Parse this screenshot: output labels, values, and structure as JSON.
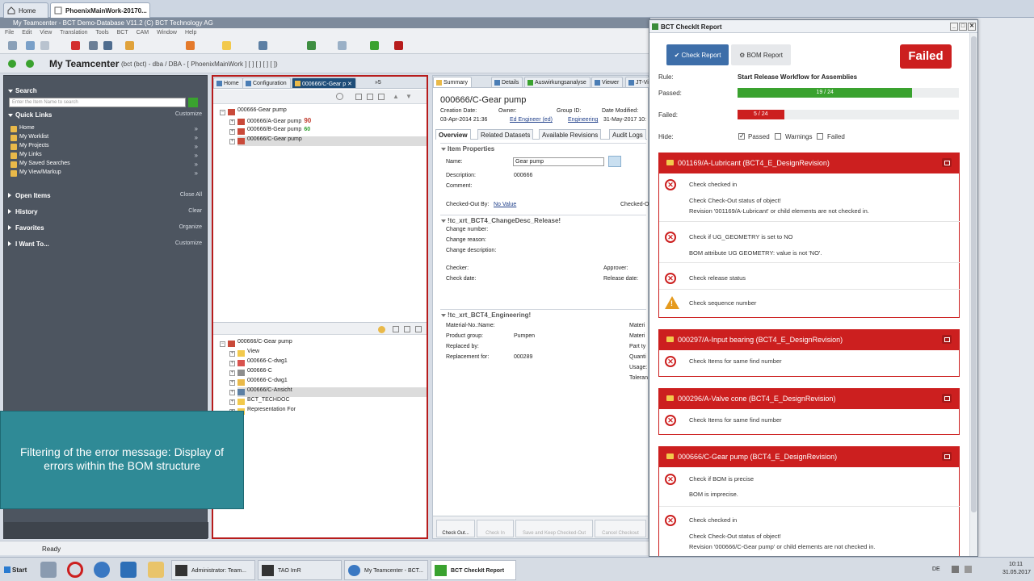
{
  "browser": {
    "tabs": [
      {
        "label": "Home",
        "active": false
      },
      {
        "label": "PhoenixMainWork-20170...",
        "active": true
      }
    ]
  },
  "app": {
    "window_title": "My Teamcenter - BCT Demo-Database V11.2 (C) BCT Technology AG",
    "menu": [
      "File",
      "Edit",
      "View",
      "Translation",
      "Tools",
      "BCT",
      "CAM",
      "Window",
      "Help"
    ],
    "header_title": "My Teamcenter",
    "header_sub": "(bct (bct) - dba / DBA - [ PhoenixMainWork ] [ ] [ ] [ ] [ ])",
    "status": "Ready"
  },
  "leftnav": {
    "search": {
      "label": "Search",
      "placeholder": "Enter the Item Name to search"
    },
    "quick_links": {
      "label": "Quick Links",
      "action": "Customize",
      "items": [
        "Home",
        "My Worklist",
        "My Projects",
        "My Links",
        "My Saved Searches",
        "My View/Markup"
      ]
    },
    "open_items": {
      "label": "Open Items",
      "action": "Close All"
    },
    "history": {
      "label": "History",
      "action": "Clear"
    },
    "favorites": {
      "label": "Favorites",
      "action": "Organize"
    },
    "iwantto": {
      "label": "I Want To...",
      "action": "Customize"
    }
  },
  "center": {
    "tabs": [
      "Home",
      "Configuration",
      "000666/C-Gear p",
      "»5"
    ],
    "tree_top": [
      {
        "label": "000666-Gear pump",
        "badge": ""
      },
      {
        "label": "000666/A-Gear pump",
        "badge": "90"
      },
      {
        "label": "000666/B-Gear pump",
        "badge": "60"
      },
      {
        "label": "000666/C-Gear pump",
        "badge": ""
      }
    ],
    "tree_bottom": [
      "000666/C-Gear pump",
      "View",
      "000666-C-dwg1",
      "000666-C",
      "000666-C-dwg1",
      "000666/C-Ansicht",
      "BCT_TECHDOC",
      "Representation For"
    ]
  },
  "props": {
    "tabs": [
      "Summary",
      "Details",
      "Auswirkungsanalyse",
      "Viewer",
      "JT-Vi"
    ],
    "title": "000666/C-Gear pump",
    "creation_date_label": "Creation Date:",
    "creation_date": "03-Apr-2014 21:36",
    "owner_label": "Owner:",
    "owner": "Ed Engineer (ed)",
    "group_label": "Group ID:",
    "group": "Engineering",
    "modified_label": "Date Modified:",
    "modified": "31-May-2017 10:",
    "overview_tabs": [
      "Overview",
      "Related Datasets",
      "Available Revisions",
      "Audit Logs"
    ],
    "sec_item": "Item Properties",
    "name_label": "Name:",
    "name_value": "Gear pump",
    "desc_label": "Description:",
    "desc_value": "000666",
    "comment_label": "Comment:",
    "checked_out_label": "Checked-Out By:",
    "checked_out_value": "No Value",
    "checked_out_right": "Checked-O",
    "sec_change": "!tc_xrt_BCT4_ChangeDesc_Release!",
    "change_number": "Change number:",
    "change_reason": "Change reason:",
    "change_desc": "Change description:",
    "checker": "Checker:",
    "approver": "Approver:",
    "check_date": "Check date:",
    "release_date": "Release date:",
    "sec_eng": "!tc_xrt_BCT4_Engineering!",
    "material_label": "Material-No.:Name:",
    "material_right": "Materi",
    "product_group_label": "Product group:",
    "product_group": "Pumpen",
    "product_right": "Materi",
    "replaced_label": "Replaced by:",
    "replaced_right": "Part ty",
    "replacement_label": "Replacement for:",
    "replacement": "000289",
    "quant_right": "Quanti",
    "usage_right": "Usage:",
    "toler_right": "Toleran",
    "buttons": [
      "Check Out...",
      "Check In",
      "Save and Keep Checked-Out",
      "Cancel Checkout"
    ]
  },
  "caption": {
    "line1": "Filtering of the error message: Display of",
    "line2": "errors within the BOM structure"
  },
  "report": {
    "title": "BCT CheckIt Report",
    "check_report_label": "Check Report",
    "bom_report_label": "BOM Report",
    "result": "Failed",
    "rule_label": "Rule:",
    "rule_value": "Start Release Workflow for Assemblies",
    "passed_label": "Passed:",
    "passed_text": "19 / 24",
    "passed_fraction": 0.79,
    "failed_label": "Failed:",
    "failed_text": "5 / 24",
    "failed_fraction": 0.21,
    "hide_label": "Hide:",
    "hide_options": [
      {
        "label": "Passed",
        "checked": true
      },
      {
        "label": "Warnings",
        "checked": false
      },
      {
        "label": "Failed",
        "checked": false
      }
    ],
    "cards": [
      {
        "title": "001169/A-Lubricant (BCT4_E_DesignRevision)",
        "c1a": "Check checked in",
        "c1b": "Check Check-Out status of object!",
        "c1c": "Revision '001169/A-Lubricant' or child elements are not checked in.",
        "c2a": "Check if UG_GEOMETRY is set to NO",
        "c2b": "BOM attribute UG GEOMETRY: value is not 'NO'.",
        "c3a": "Check release status",
        "c4a": "Check sequence number"
      },
      {
        "title": "000297/A-Input bearing (BCT4_E_DesignRevision)",
        "c1a": "Check Items for same find number"
      },
      {
        "title": "000296/A-Valve cone (BCT4_E_DesignRevision)",
        "c1a": "Check Items for same find number"
      },
      {
        "title": "000666/C-Gear pump (BCT4_E_DesignRevision)",
        "c1a": "Check if BOM is precise",
        "c1b": "BOM is imprecise.",
        "c2a": "Check checked in",
        "c2b": "Check Check-Out status of object!",
        "c2c": "Revision '000666/C-Gear pump' or child elements are not checked in."
      }
    ]
  },
  "taskbar": {
    "start": "Start",
    "tasks": [
      "Administrator: Team...",
      "TAO ImR",
      "My Teamcenter - BCT...",
      "BCT CheckIt Report"
    ],
    "lang": "DE",
    "time": "10:11",
    "date": "31.05.2017"
  },
  "colors": {
    "accent": "#3d6ea9",
    "fail": "#cc1f1f",
    "pass": "#3aa22f",
    "warn": "#e59a1e"
  }
}
